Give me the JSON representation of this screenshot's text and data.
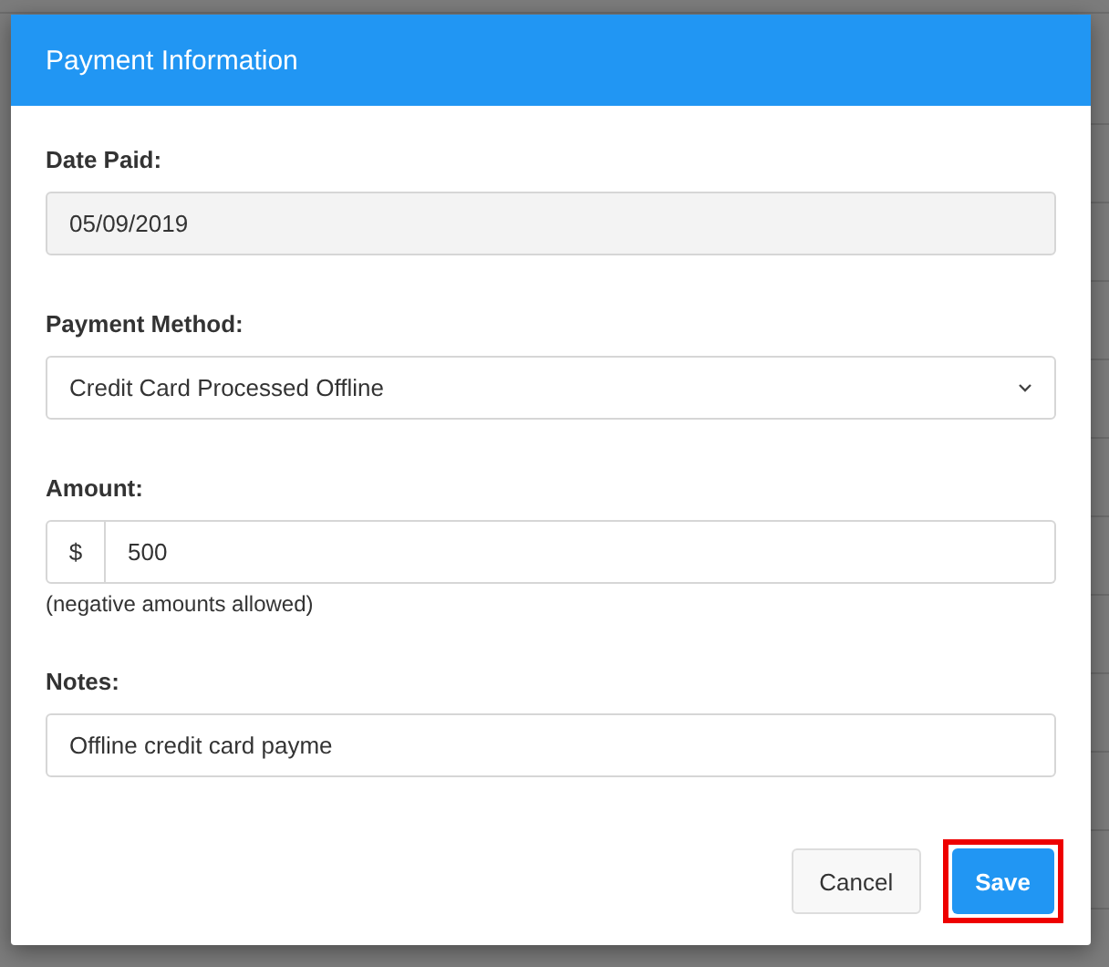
{
  "dialog": {
    "title": "Payment Information"
  },
  "fields": [
    {
      "kind": "text",
      "label": "Date Paid:",
      "value": "05/09/2019",
      "disabled": true
    },
    {
      "kind": "select",
      "label": "Payment Method:",
      "value": "Credit Card Processed Offline"
    },
    {
      "kind": "money",
      "label": "Amount:",
      "prefix": "$",
      "value": "500",
      "hint": "(negative amounts allowed)"
    },
    {
      "kind": "text",
      "label": "Notes:",
      "value": "Offline credit card payme",
      "disabled": false
    }
  ],
  "buttons": [
    {
      "kind": "secondary",
      "label": "Cancel",
      "highlighted": false
    },
    {
      "kind": "primary",
      "label": "Save",
      "highlighted": true
    }
  ]
}
